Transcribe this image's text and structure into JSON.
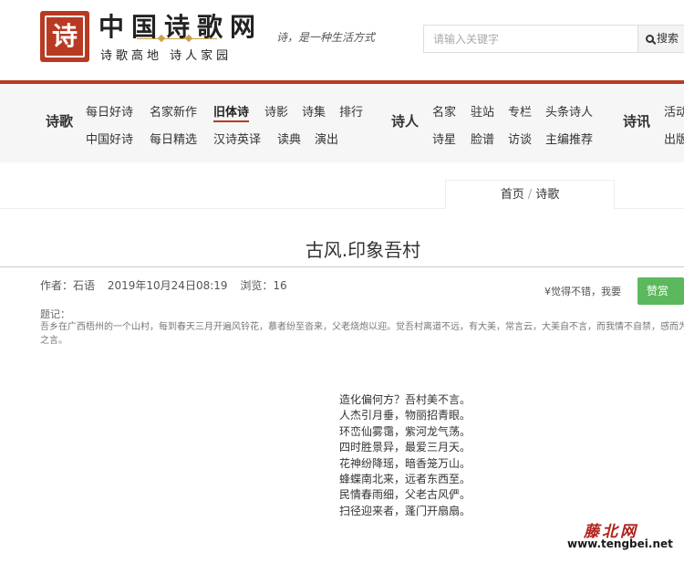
{
  "header": {
    "logo_glyph": "诗",
    "site_name": "中国诗歌网",
    "site_sub": "诗歌高地 诗人家园",
    "slogan": "诗，是一种生活方式",
    "search_placeholder": "请输入关键字",
    "search_button": "搜索"
  },
  "nav": {
    "groups": [
      {
        "category": "诗歌",
        "row1": [
          "每日好诗",
          "名家新作",
          "旧体诗",
          "诗影",
          "诗集",
          "排行"
        ],
        "row2": [
          "中国好诗",
          "每日精选",
          "汉诗英译",
          "读典",
          "演出"
        ]
      },
      {
        "category": "诗人",
        "row1": [
          "名家",
          "驻站",
          "专栏",
          "头条诗人"
        ],
        "row2": [
          "诗星",
          "脸谱",
          "访谈",
          "主编推荐"
        ]
      },
      {
        "category": "诗讯",
        "row1": [
          "活动"
        ],
        "row2": [
          "出版"
        ]
      }
    ],
    "active_item": "旧体诗"
  },
  "breadcrumb": {
    "home": "首页",
    "separator": "/",
    "current": "诗歌"
  },
  "article": {
    "title": "古风.印象吾村",
    "author_label": "作者：",
    "author": "石语",
    "date": "2019年10月24日08:19",
    "views_label": "浏览：",
    "views": "16",
    "praise_text": "¥觉得不错，我要",
    "praise_button": "赞赏",
    "note_label": "题记：",
    "note_text": "吾乡在广西梧州的一个山村，每到春天三月开遍风铃花，慕者纷至沓来，父老烧炮以迎。觉吾村离道不远，有大美，常言云，大美自不言，而我情不自禁，感而为之言。",
    "poem": [
      "造化偏何方？吾村美不言。",
      "人杰引月垂，物丽招青眼。",
      "环峦仙雾霭，紫河龙气荡。",
      "四时胜景异，最爱三月天。",
      "花神纷降瑶，暗香笼万山。",
      "蜂蝶南北来，远者东西至。",
      "民情春雨细，父老古风俨。",
      "扫径迎来者，蓬门开扇扇。"
    ]
  },
  "watermark": {
    "cn": "藤北网",
    "url": "www.tengbei.net"
  }
}
